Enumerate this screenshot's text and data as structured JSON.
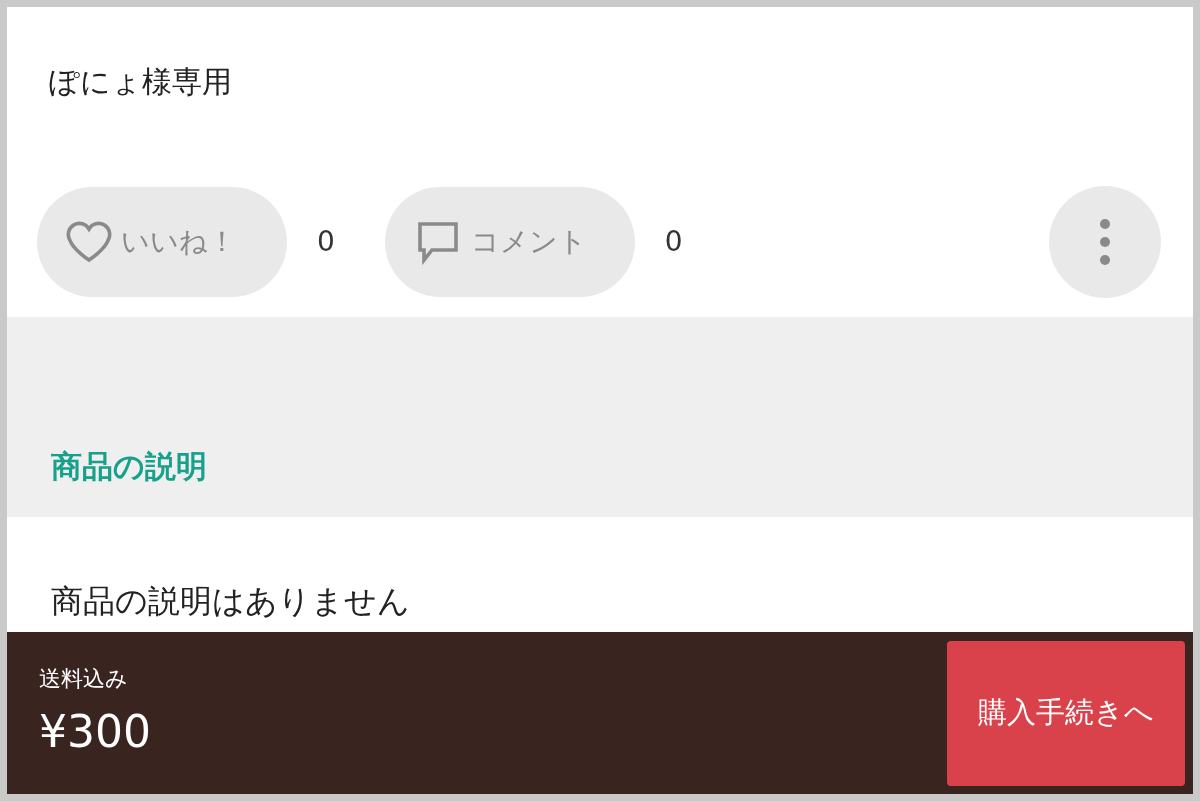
{
  "item": {
    "title": "ぽにょ様専用"
  },
  "actions": [
    {
      "kind": "like",
      "label": "いいね！",
      "count": "0"
    },
    {
      "kind": "comment",
      "label": "コメント",
      "count": "0"
    }
  ],
  "description": {
    "heading": "商品の説明",
    "body": "商品の説明はありません"
  },
  "purchase_bar": {
    "shipping_note": "送料込み",
    "price": "¥300",
    "button": "購入手続きへ"
  }
}
